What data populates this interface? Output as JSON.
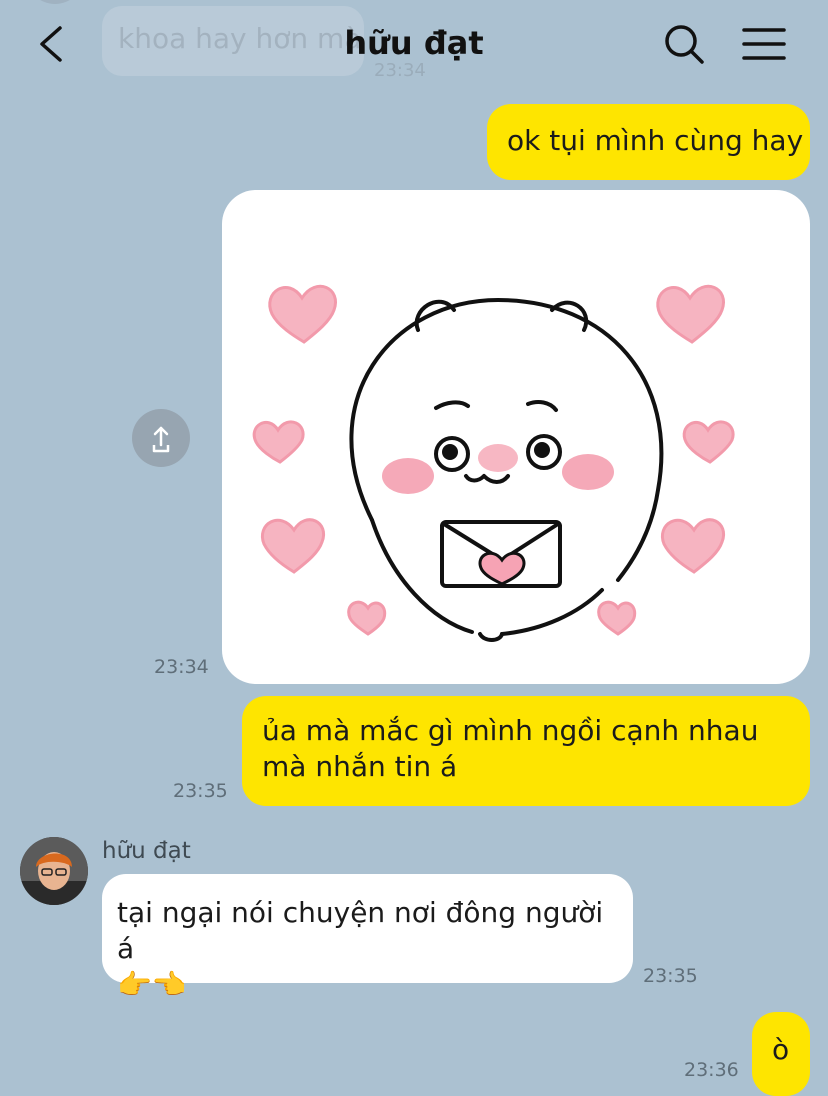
{
  "header": {
    "title": "hữu đạt",
    "faded_message": "khoa hay hơn mà",
    "faded_time": "23:34"
  },
  "messages": [
    {
      "sender": "me",
      "text": "ok tụi mình cùng hay",
      "time": ""
    },
    {
      "sender": "me",
      "type": "sticker",
      "sticker": "bear-with-heart-letter",
      "time": "23:34"
    },
    {
      "sender": "me",
      "text": "ủa mà mắc gì mình ngồi cạnh nhau mà nhắn tin á",
      "time": "23:35"
    },
    {
      "sender": "other",
      "name": "hữu đạt",
      "text": "tại ngại nói chuyện nơi đông người á",
      "emoji": "👉👈",
      "time": "23:35"
    },
    {
      "sender": "me",
      "text": "ò",
      "time": "23:36"
    }
  ],
  "icons": {
    "back": "chevron-left-icon",
    "search": "search-icon",
    "menu": "hamburger-menu-icon",
    "share": "share-icon"
  },
  "colors": {
    "background": "#abc1d1",
    "my_bubble": "#fee500",
    "other_bubble": "#ffffff",
    "timestamp": "#5f6e79"
  }
}
